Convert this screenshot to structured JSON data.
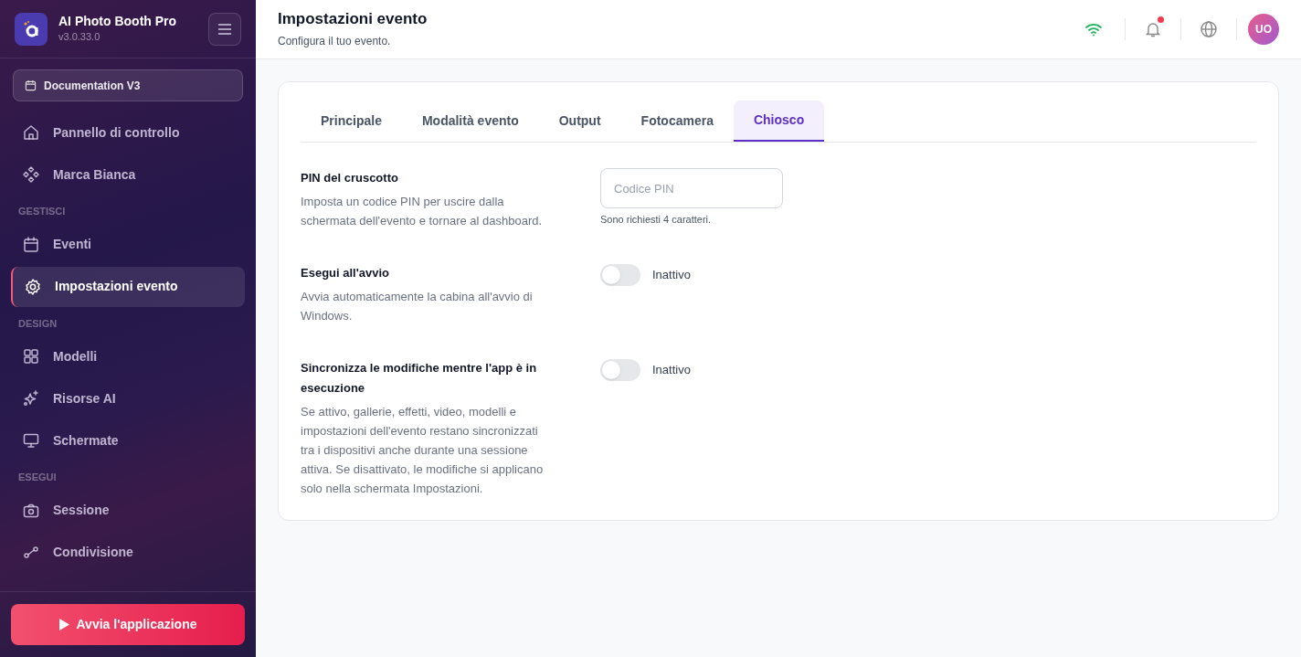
{
  "app": {
    "name": "AI Photo Booth Pro",
    "version": "v3.0.33.0"
  },
  "event_selector": {
    "label": "Documentation V3"
  },
  "sidebar": {
    "sections": [
      {
        "items": [
          {
            "label": "Pannello di controllo",
            "selected": false
          },
          {
            "label": "Marca Bianca",
            "selected": false
          }
        ]
      },
      {
        "heading": "GESTISCI",
        "items": [
          {
            "label": "Eventi",
            "selected": false
          },
          {
            "label": "Impostazioni evento",
            "selected": true
          }
        ]
      },
      {
        "heading": "DESIGN",
        "items": [
          {
            "label": "Modelli",
            "selected": false
          },
          {
            "label": "Risorse AI",
            "selected": false
          },
          {
            "label": "Schermate",
            "selected": false
          }
        ]
      },
      {
        "heading": "ESEGUI",
        "items": [
          {
            "label": "Sessione",
            "selected": false
          },
          {
            "label": "Condivisione",
            "selected": false
          }
        ]
      }
    ],
    "launch_button": "Avvia l'applicazione"
  },
  "header": {
    "title": "Impostazioni evento",
    "subtitle": "Configura il tuo evento.",
    "notification_dot": true,
    "avatar": "UO"
  },
  "tabs": [
    {
      "label": "Principale",
      "selected": false
    },
    {
      "label": "Modalità evento",
      "selected": false
    },
    {
      "label": "Output",
      "selected": false
    },
    {
      "label": "Fotocamera",
      "selected": false
    },
    {
      "label": "Chiosco",
      "selected": true
    }
  ],
  "settings": [
    {
      "kind": "pin",
      "title": "PIN del cruscotto",
      "description": "Imposta un codice PIN per uscire dalla schermata dell'evento e tornare al dashboard.",
      "placeholder": "Codice PIN",
      "hint": "Sono richiesti 4 caratteri."
    },
    {
      "kind": "toggle",
      "title": "Esegui all'avvio",
      "description": "Avvia automaticamente la cabina all'avvio di Windows.",
      "on": false,
      "state_label": "Inattivo"
    },
    {
      "kind": "toggle",
      "title": "Sincronizza le modifiche mentre l'app è in esecuzione",
      "description": "Se attivo, gallerie, effetti, video, modelli e impostazioni dell'evento restano sincronizzati tra i dispositivi anche durante una sessione attiva. Se disattivato, le modifiche si applicano solo nella schermata Impostazioni.",
      "on": false,
      "state_label": "Inattivo"
    }
  ]
}
